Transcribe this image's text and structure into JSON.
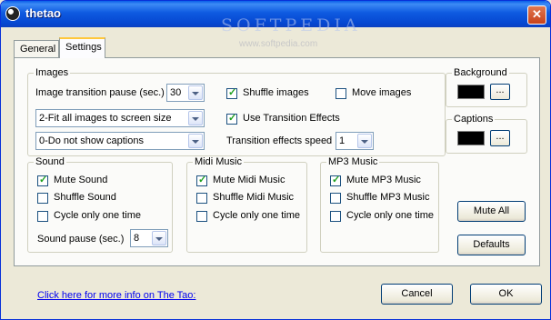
{
  "window": {
    "title": "thetao",
    "close_symbol": "✕"
  },
  "watermark": {
    "brand": "SOFTPEDIA",
    "url": "www.softpedia.com"
  },
  "tabs": [
    "General",
    "Settings"
  ],
  "images": {
    "label": "Images",
    "transition_pause_label": "Image transition pause (sec.)",
    "transition_pause_value": "30",
    "fit_mode_value": "2-Fit all images to screen size",
    "captions_mode_value": "0-Do not show captions",
    "shuffle_label": "Shuffle images",
    "shuffle_checked": true,
    "move_label": "Move images",
    "move_checked": false,
    "transition_effects_label": "Use Transition Effects",
    "transition_effects_checked": true,
    "effects_speed_label": "Transition effects speed",
    "effects_speed_value": "1"
  },
  "background": {
    "label": "Background",
    "color": "#000000",
    "button_label": "..."
  },
  "captions": {
    "label": "Captions",
    "color": "#000000",
    "button_label": "..."
  },
  "sound": {
    "label": "Sound",
    "mute_label": "Mute Sound",
    "mute_checked": true,
    "shuffle_label": "Shuffle Sound",
    "shuffle_checked": false,
    "cycle_label": "Cycle only one time",
    "cycle_checked": false,
    "pause_label": "Sound pause (sec.)",
    "pause_value": "8"
  },
  "midi": {
    "label": "Midi Music",
    "mute_label": "Mute Midi Music",
    "mute_checked": true,
    "shuffle_label": "Shuffle Midi Music",
    "shuffle_checked": false,
    "cycle_label": "Cycle only one time",
    "cycle_checked": false
  },
  "mp3": {
    "label": "MP3 Music",
    "mute_label": "Mute MP3 Music",
    "mute_checked": true,
    "shuffle_label": "Shuffle MP3 Music",
    "shuffle_checked": false,
    "cycle_label": "Cycle only one time",
    "cycle_checked": false
  },
  "buttons": {
    "mute_all": "Mute All",
    "defaults": "Defaults",
    "cancel": "Cancel",
    "ok": "OK"
  },
  "footer": {
    "info_link": "Click here for more info on The Tao:"
  }
}
